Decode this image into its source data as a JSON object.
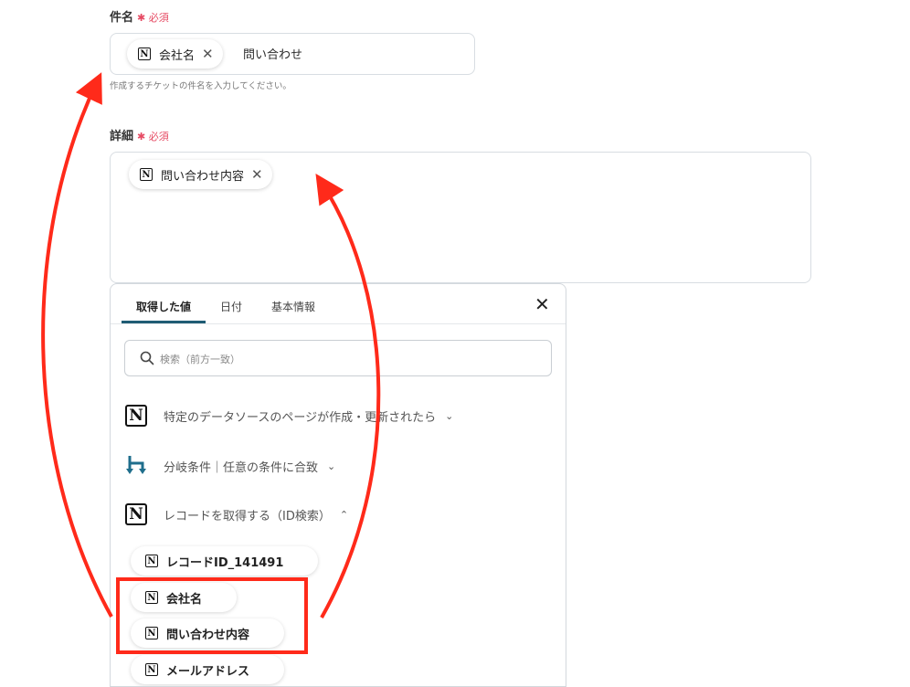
{
  "subject": {
    "label": "件名",
    "required": "必須",
    "chip_label": "会社名",
    "trailing_text": "問い合わせ",
    "help": "作成するチケットの件名を入力してください。"
  },
  "detail": {
    "label": "詳細",
    "required": "必須",
    "chip_label": "問い合わせ内容"
  },
  "picker": {
    "tabs": [
      "取得した値",
      "日付",
      "基本情報"
    ],
    "search_placeholder": "検索（前方一致）",
    "groups": [
      {
        "label": "特定のデータソースのページが作成・更新されたら",
        "icon": "notion-icon",
        "expanded": false
      },
      {
        "label": "分岐条件｜任意の条件に合致",
        "icon": "branch-icon",
        "expanded": false
      },
      {
        "label": "レコードを取得する（ID検索）",
        "icon": "notion-icon",
        "expanded": true
      }
    ],
    "items": [
      "レコードID_141491",
      "会社名",
      "問い合わせ内容",
      "メールアドレス"
    ]
  },
  "annotation": {
    "highlight_color": "#ff2a1a"
  }
}
